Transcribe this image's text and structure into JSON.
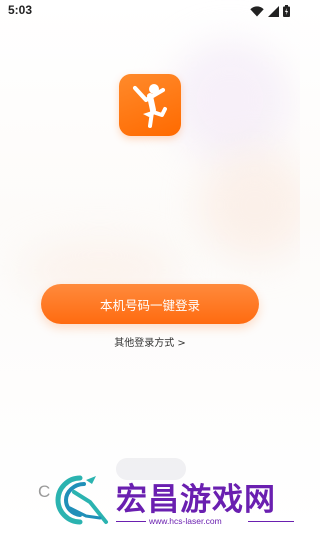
{
  "status_bar": {
    "time": "5:03",
    "icons": [
      "wifi-icon",
      "signal-icon",
      "battery-icon"
    ]
  },
  "app": {
    "logo_icon": "dancer-icon",
    "accent_color": "#ff6b10"
  },
  "login": {
    "primary_button_label": "本机号码一键登录",
    "other_methods_label": "其他登录方式 >"
  },
  "bottom": {
    "partial_glyph": "C"
  },
  "watermark": {
    "title": "宏昌游戏网",
    "url": "www.hcs-laser.com",
    "color": "#6a1fb0"
  }
}
